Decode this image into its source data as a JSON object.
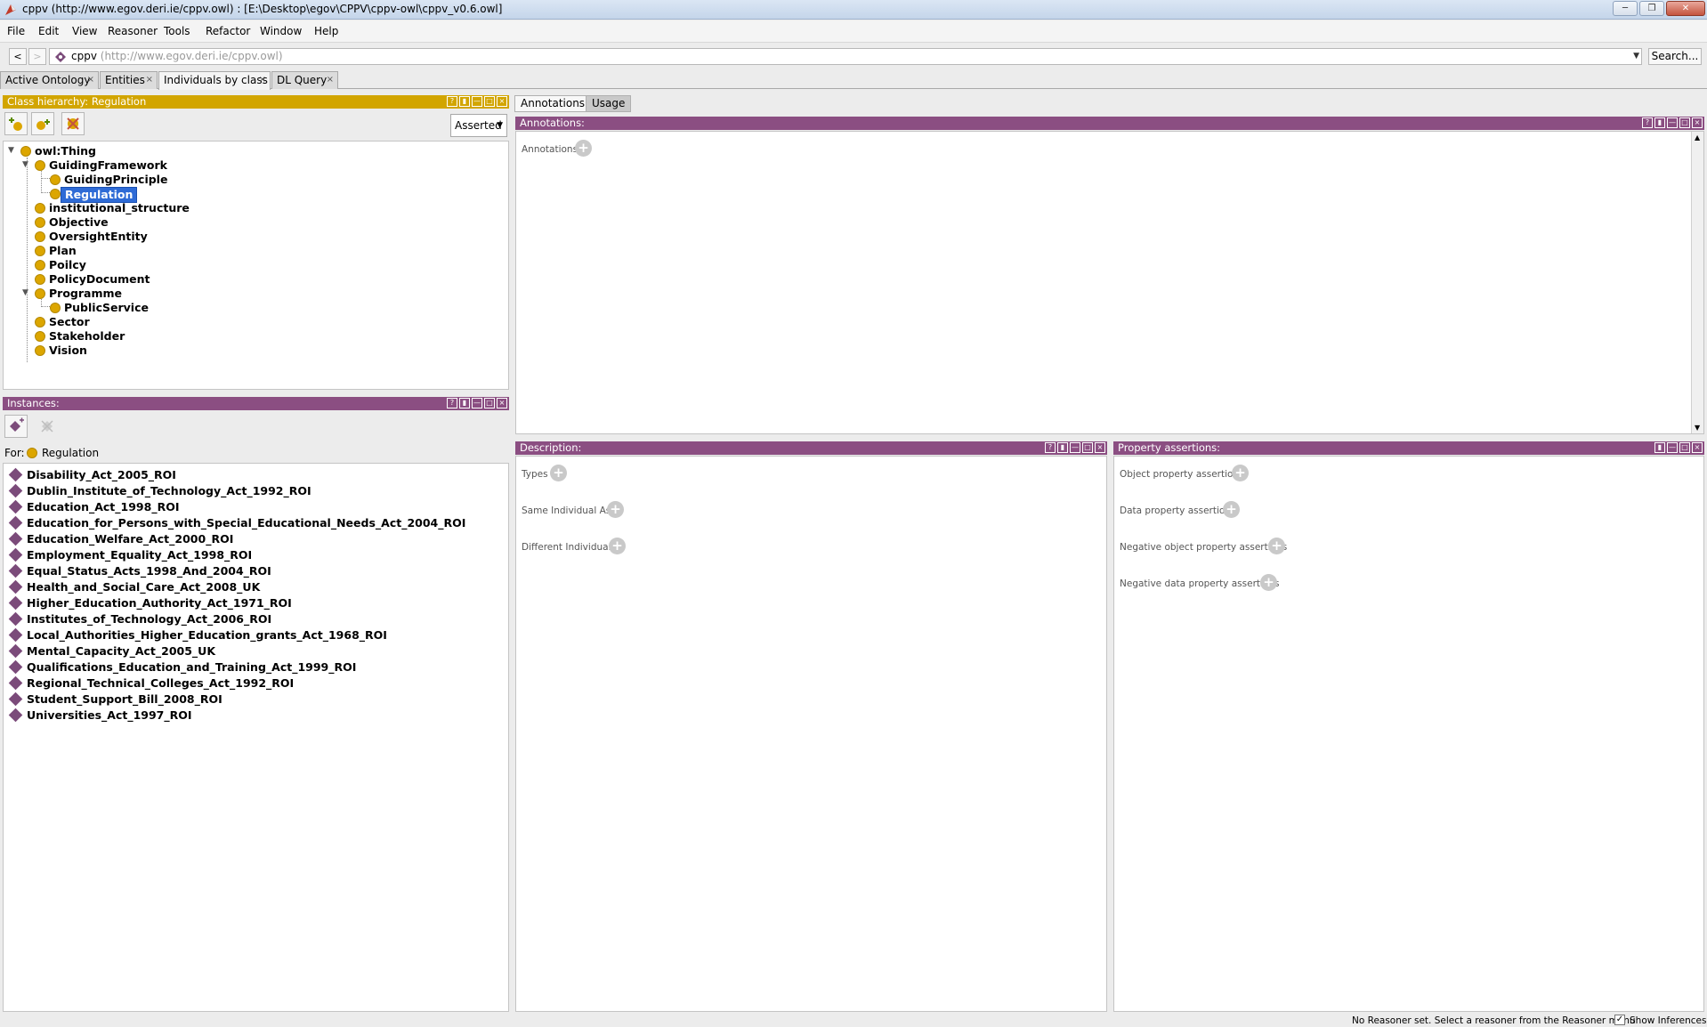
{
  "window": {
    "title": "cppv (http://www.egov.deri.ie/cppv.owl)  : [E:\\Desktop\\egov\\CPPV\\cppv-owl\\cppv_v0.6.owl]"
  },
  "menu": [
    "File",
    "Edit",
    "View",
    "Reasoner",
    "Tools",
    "Refactor",
    "Window",
    "Help"
  ],
  "address": {
    "ontology_name": "cppv",
    "ontology_iri": "(http://www.egov.deri.ie/cppv.owl)",
    "search_label": "Search..."
  },
  "tabs": [
    {
      "label": "Active Ontology"
    },
    {
      "label": "Entities"
    },
    {
      "label": "Individuals by class"
    },
    {
      "label": "DL Query"
    }
  ],
  "class_hierarchy": {
    "title": "Class hierarchy: Regulation",
    "mode": "Asserted",
    "nodes": [
      {
        "label": "owl:Thing"
      },
      {
        "label": "GuidingFramework"
      },
      {
        "label": "GuidingPrinciple"
      },
      {
        "label": "Regulation"
      },
      {
        "label": "institutional_structure"
      },
      {
        "label": "Objective"
      },
      {
        "label": "OversightEntity"
      },
      {
        "label": "Plan"
      },
      {
        "label": "Poilcy"
      },
      {
        "label": "PolicyDocument"
      },
      {
        "label": "Programme"
      },
      {
        "label": "PublicService"
      },
      {
        "label": "Sector"
      },
      {
        "label": "Stakeholder"
      },
      {
        "label": "Vision"
      }
    ]
  },
  "instances": {
    "title": "Instances:",
    "for_label": "For:",
    "for_class": "Regulation",
    "items": [
      "Disability_Act_2005_ROI",
      "Dublin_Institute_of_Technology_Act_1992_ROI",
      "Education_Act_1998_ROI",
      "Education_for_Persons_with_Special_Educational_Needs_Act_2004_ROI",
      "Education_Welfare_Act_2000_ROI",
      "Employment_Equality_Act_1998_ROI",
      "Equal_Status_Acts_1998_And_2004_ROI",
      "Health_and_Social_Care_Act_2008_UK",
      "Higher_Education_Authority_Act_1971_ROI",
      "Institutes_of_Technology_Act_2006_ROI",
      "Local_Authorities_Higher_Education_grants_Act_1968_ROI",
      "Mental_Capacity_Act_2005_UK",
      "Qualifications_Education_and_Training_Act_1999_ROI",
      "Regional_Technical_Colleges_Act_1992_ROI",
      "Student_Support_Bill_2008_ROI",
      "Universities_Act_1997_ROI"
    ]
  },
  "right_tabs": [
    "Annotations",
    "Usage"
  ],
  "annotations": {
    "title": "Annotations:",
    "section": "Annotations"
  },
  "description": {
    "title": "Description:",
    "sections": [
      "Types",
      "Same Individual As",
      "Different Individuals"
    ]
  },
  "property_assertions": {
    "title": "Property assertions:",
    "sections": [
      "Object property assertions",
      "Data property assertions",
      "Negative object property assertions",
      "Negative data property assertions"
    ]
  },
  "status": {
    "message": "No Reasoner set. Select a reasoner from the Reasoner menu",
    "show_inferences": "Show Inferences"
  },
  "colors": {
    "class_panel_header": "#d2a500",
    "purple_panel_header": "#8b4e82",
    "class_dot": "#dca600",
    "individual_diamond": "#7b4b7a",
    "selection": "#2e6bd6"
  }
}
